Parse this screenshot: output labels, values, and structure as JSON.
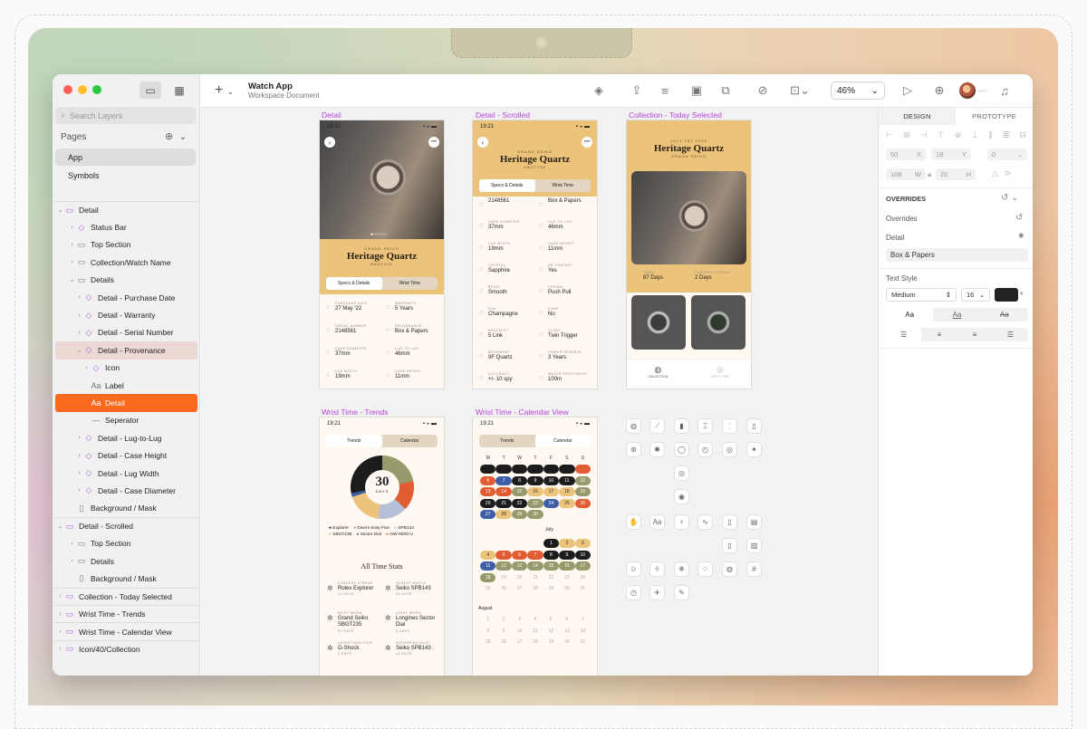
{
  "window": {
    "app_title": "Watch App",
    "subtitle": "Workspace Document",
    "zoom": "46%"
  },
  "sidebar": {
    "search_placeholder": "Search Layers",
    "pages_heading": "Pages",
    "pages": [
      "App",
      "Symbols"
    ],
    "layers": [
      {
        "label": "Detail",
        "depth": 0,
        "type": "section",
        "arrow": "⌄",
        "icon": "▭"
      },
      {
        "label": "Status Bar",
        "depth": 1,
        "arrow": "›",
        "icon": "◇"
      },
      {
        "label": "Top Section",
        "depth": 1,
        "arrow": "›",
        "icon": "▭"
      },
      {
        "label": "Collection/Watch Name",
        "depth": 1,
        "arrow": "›",
        "icon": "▭"
      },
      {
        "label": "Details",
        "depth": 1,
        "arrow": "⌄",
        "icon": "▭"
      },
      {
        "label": "Detail - Purchase Date",
        "depth": 2,
        "arrow": "›",
        "icon": "◇"
      },
      {
        "label": "Detail - Warranty",
        "depth": 2,
        "arrow": "›",
        "icon": "◇"
      },
      {
        "label": "Detail - Serial Number",
        "depth": 2,
        "arrow": "›",
        "icon": "◇"
      },
      {
        "label": "Detail - Provenance",
        "depth": 2,
        "arrow": "⌄",
        "icon": "◇",
        "state": "hl"
      },
      {
        "label": "Icon",
        "depth": 3,
        "arrow": "›",
        "icon": "◇"
      },
      {
        "label": "Label",
        "depth": 3,
        "arrow": "",
        "icon": "Aa"
      },
      {
        "label": "Detail",
        "depth": 3,
        "arrow": "",
        "icon": "Aa",
        "state": "sel"
      },
      {
        "label": "Seperator",
        "depth": 3,
        "arrow": "",
        "icon": "—"
      },
      {
        "label": "Detail - Lug-to-Lug",
        "depth": 2,
        "arrow": "›",
        "icon": "◇"
      },
      {
        "label": "Detail - Case Height",
        "depth": 2,
        "arrow": "›",
        "icon": "◇"
      },
      {
        "label": "Detail - Lug Width",
        "depth": 2,
        "arrow": "›",
        "icon": "◇"
      },
      {
        "label": "Detail - Case Diameter",
        "depth": 2,
        "arrow": "›",
        "icon": "◇"
      },
      {
        "label": "Background / Mask",
        "depth": 1,
        "arrow": "",
        "icon": "▯"
      },
      {
        "label": "Detail - Scrolled",
        "depth": 0,
        "type": "section",
        "arrow": "⌄",
        "icon": "▭"
      },
      {
        "label": "Top Section",
        "depth": 1,
        "arrow": "›",
        "icon": "▭"
      },
      {
        "label": "Details",
        "depth": 1,
        "arrow": "›",
        "icon": "▭"
      },
      {
        "label": "Background / Mask",
        "depth": 1,
        "arrow": "",
        "icon": "▯"
      },
      {
        "label": "Collection - Today Selected",
        "depth": 0,
        "type": "section",
        "arrow": "›",
        "icon": "▭"
      },
      {
        "label": "Wrist Time - Trends",
        "depth": 0,
        "type": "section",
        "arrow": "›",
        "icon": "▭"
      },
      {
        "label": "Wrist Time - Calendar View",
        "depth": 0,
        "type": "section",
        "arrow": "›",
        "icon": "▭"
      },
      {
        "label": "Icon/40/Collection",
        "depth": 0,
        "type": "section",
        "arrow": "›",
        "icon": "▭"
      }
    ]
  },
  "artboards": {
    "detail": {
      "label": "Detail",
      "time": "19:21",
      "kicker": "GRAND SEIKO",
      "title": "Heritage Quartz",
      "ref": "SBGT235",
      "tabs": [
        "Specs & Details",
        "Wrist Time"
      ],
      "specs": [
        [
          "PURCHASE DATE",
          "27 May '22"
        ],
        [
          "WARRANTY",
          "5 Years"
        ],
        [
          "SERIAL NUMBER",
          "2148561"
        ],
        [
          "PROVENANCE",
          "Box & Papers"
        ],
        [
          "CASE DIAMETER",
          "37mm"
        ],
        [
          "LUG-TO-LUG",
          "46mm"
        ],
        [
          "LUG WIDTH",
          "19mm"
        ],
        [
          "CASE HEIGHT",
          "11mm"
        ]
      ]
    },
    "scrolled": {
      "label": "Detail - Scrolled",
      "time": "19:21",
      "kicker": "GRAND SEIKO",
      "title": "Heritage Quartz",
      "ref": "SBGT235",
      "tabs": [
        "Specs & Details",
        "Wrist Time"
      ],
      "specs": [
        [
          "",
          "2148561"
        ],
        [
          "",
          "Box & Papers"
        ],
        [
          "CASE DIAMETER",
          "37mm"
        ],
        [
          "LUG-TO-LUG",
          "46mm"
        ],
        [
          "LUG WIDTH",
          "19mm"
        ],
        [
          "CASE HEIGHT",
          "11mm"
        ],
        [
          "CRYSTAL",
          "Sapphire"
        ],
        [
          "AR COATING",
          "Yes"
        ],
        [
          "BEZEL",
          "Smooth"
        ],
        [
          "CROWN",
          "Push Pull"
        ],
        [
          "DIAL",
          "Champagne"
        ],
        [
          "LUME",
          "No"
        ],
        [
          "BRACELET",
          "5 Link"
        ],
        [
          "CLASP",
          "Twin Trigger"
        ],
        [
          "MOVEMENT",
          "9F Quartz"
        ],
        [
          "POWER RESERVE",
          "3 Years"
        ],
        [
          "ACCURACY",
          "+/- 10 spy"
        ],
        [
          "WATER RESISTANCE",
          "100m"
        ]
      ]
    },
    "collection": {
      "label": "Collection - Today Selected",
      "kicker_top": "JULY 1ST 2023",
      "title": "Heritage Quartz",
      "kicker": "GRAND SEIKO",
      "stats": [
        [
          "TOTAL",
          "87 Days"
        ],
        [
          "CURRENT STREAK",
          "2 Days"
        ]
      ],
      "nav": [
        "COLLECTION",
        "WRIST TIME"
      ]
    },
    "trends": {
      "label": "Wrist Time - Trends",
      "time": "19:21",
      "tabs": [
        "Trends",
        "Calendar"
      ],
      "donut_number": "30",
      "donut_unit": "DAYS",
      "legend": [
        "Explorer",
        "Divers Sixty Five",
        "SPB143",
        "SBGT235",
        "Sector Dial",
        "GW-5000-U"
      ],
      "stats_title": "All Time Stats",
      "stats": [
        [
          "LONGEST STREAK",
          "Rolex Explorer",
          "21 DAYS"
        ],
        [
          "OLDEST WATCH",
          "Seiko SPB143",
          "21 DAYS"
        ],
        [
          "MOST WORN",
          "Grand Seiko SBGT235",
          "87 DAYS"
        ],
        [
          "LEAST WORN",
          "Longines Sector Dial",
          "3 DAYS"
        ],
        [
          "LATEST ADDITION",
          "G-Shock",
          "2 DAYS"
        ],
        [
          "GATHERING DUST",
          "Seiko SPB143",
          "13 DAYS"
        ]
      ]
    },
    "calendar": {
      "label": "Wrist Time - Calendar View",
      "time": "19:21",
      "tabs": [
        "Trends",
        "Calendar"
      ],
      "weekdays": [
        "M",
        "T",
        "W",
        "T",
        "F",
        "S",
        "S"
      ],
      "month2": "July",
      "month3": "August"
    }
  },
  "inspector": {
    "tabs": [
      "DESIGN",
      "PROTOTYPE"
    ],
    "x": "50",
    "y": "18",
    "rot": "0",
    "w": "108",
    "h": "20",
    "overrides_h": "OVERRIDES",
    "overrides_label": "Overrides",
    "detail_label": "Detail",
    "detail_value": "Box & Papers",
    "text_style_h": "Text Style",
    "weight": "Medium",
    "size": "16",
    "aa_labels": [
      "Aa",
      "Aa",
      "Aa"
    ]
  },
  "colors": {
    "accent_orange": "#fb6a1f",
    "mustard": "#ecc37a",
    "purple_label": "#b743d8"
  }
}
